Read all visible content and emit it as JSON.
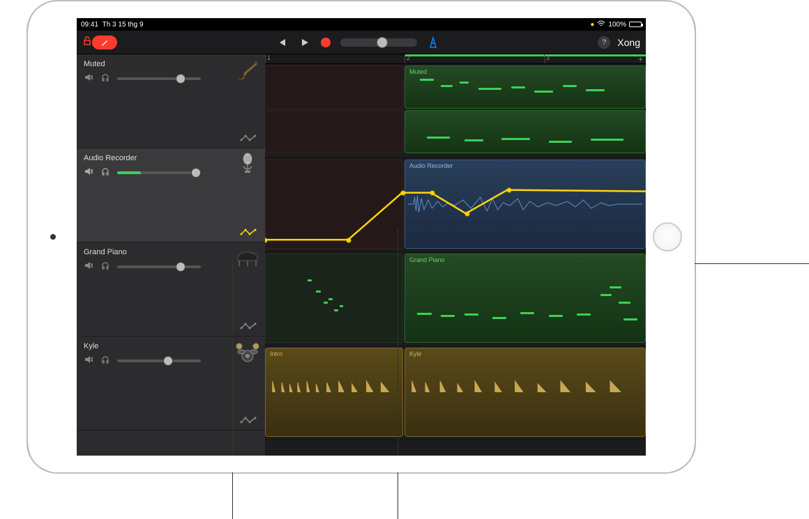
{
  "status": {
    "time": "09:41",
    "date": "Th 3 15 thg 9",
    "battery": "100%"
  },
  "toolbar": {
    "done": "Xong"
  },
  "ruler": {
    "m1": "1",
    "m2": "2",
    "m3": "3"
  },
  "tracks": [
    {
      "name": "Muted",
      "region2_label": "Muted",
      "automation_active": false
    },
    {
      "name": "Audio Recorder",
      "region2_label": "Audio Recorder",
      "automation_active": true
    },
    {
      "name": "Grand Piano",
      "region2_label": "Grand Piano",
      "automation_active": false
    },
    {
      "name": "Kyle",
      "region1_label": "Intro",
      "region2_label": "Kyle",
      "automation_active": false
    }
  ]
}
